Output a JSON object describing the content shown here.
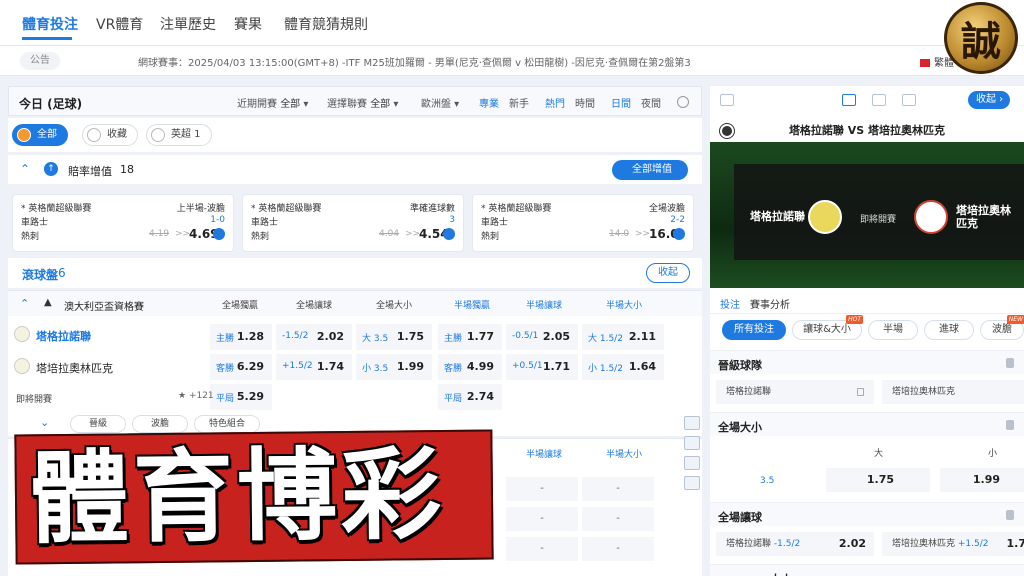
{
  "topnav": {
    "tabs": [
      "體育投注",
      "VR體育",
      "注單歷史",
      "賽果",
      "體育競猜規則"
    ],
    "logo_char": "誠"
  },
  "notice": {
    "label": "公告",
    "text": "網球賽事：2025/04/03 13:15:00(GMT+8) -ITF M25班加羅爾 - 男單(尼克·查佩爾 v 松田龍樹) -因尼克·查佩爾在第2盤第3",
    "lang": "繁體"
  },
  "main": {
    "title": "今日 (足球)",
    "filters": [
      {
        "label": "近期開賽",
        "value": "全部"
      },
      {
        "label": "選擇聯賽",
        "value": "全部"
      },
      {
        "label": "歐洲盤",
        "value": ""
      }
    ],
    "toggles": [
      "專業",
      "新手",
      "熱門",
      "時間",
      "日間",
      "夜間"
    ],
    "chips": [
      "全部",
      "收藏",
      "英超 1"
    ],
    "boost": {
      "title": "賠率增值",
      "count": "18",
      "all_label": "全部增值"
    },
    "boost_cards": [
      {
        "league": "* 英格蘭超級聯賽",
        "market": "上半場-波膽",
        "team1": "車路士",
        "hc": "1-0",
        "team2": "熱刺",
        "old": "4.19",
        "arrow": ">>",
        "new": "4.69"
      },
      {
        "league": "* 英格蘭超級聯賽",
        "market": "準確進球數",
        "team1": "車路士",
        "hc": "3",
        "team2": "熱刺",
        "old": "4.04",
        "arrow": ">>",
        "new": "4.54"
      },
      {
        "league": "* 英格蘭超級聯賽",
        "market": "全場波膽",
        "team1": "車路士",
        "hc": "2-2",
        "team2": "熱刺",
        "old": "14.0",
        "arrow": ">>",
        "new": "16.0"
      }
    ],
    "live": {
      "title": "滾球盤",
      "count": "6",
      "collapse": "收起"
    },
    "league": {
      "name": "澳大利亞盃資格賽",
      "cols": [
        "全場獨贏",
        "全場讓球",
        "全場大小",
        "半場獨贏",
        "半場讓球",
        "半場大小"
      ]
    },
    "match": {
      "home": "塔格拉諾聯",
      "away": "塔培拉奧林匹克",
      "status": "即將開賽",
      "more": "+121",
      "home_odds": [
        [
          "主勝",
          "1.28"
        ],
        [
          "-1.5/2",
          "2.02"
        ],
        [
          "大 3.5",
          "1.75"
        ],
        [
          "主勝",
          "1.77"
        ],
        [
          "-0.5/1",
          "2.05"
        ],
        [
          "大 1.5/2",
          "2.11"
        ]
      ],
      "away_odds": [
        [
          "客勝",
          "6.29"
        ],
        [
          "+1.5/2",
          "1.74"
        ],
        [
          "小 3.5",
          "1.99"
        ],
        [
          "客勝",
          "4.99"
        ],
        [
          "+0.5/1",
          "1.71"
        ],
        [
          "小 1.5/2",
          "1.64"
        ]
      ],
      "draw_odds": [
        [
          "平局",
          "5.29"
        ],
        [
          "平局",
          "2.74"
        ]
      ]
    },
    "subtabs": [
      "晉級",
      "波膽",
      "特色組合"
    ],
    "lower_cols": [
      "半場讓球",
      "半場大小"
    ],
    "dash": "-"
  },
  "right": {
    "collapse": "收起",
    "vs_title": "塔格拉諾聯  VS  塔培拉奧林匹克",
    "home": "塔格拉諾聯",
    "away": "塔培拉奧林匹克",
    "soon": "即將開賽",
    "tabs": [
      "投注",
      "賽事分析"
    ],
    "filters": [
      "所有投注",
      "讓球&大小",
      "半場",
      "進球",
      "波膽"
    ],
    "hot": "HOT",
    "new_tag": "NEW",
    "sections": {
      "advance": "晉級球隊",
      "ou": "全場大小",
      "hcp": "全場讓球",
      "ou_half": "大小"
    },
    "advance_home": "塔格拉諾聯",
    "advance_away": "塔培拉奧林匹克",
    "ou_over": "大",
    "ou_under": "小",
    "ou_line": "3.5",
    "ou_over_odds": "1.75",
    "ou_under_odds": "1.99",
    "hcp_home": "塔格拉諾聯",
    "hcp_home_line": "-1.5/2",
    "hcp_home_odds": "2.02",
    "hcp_away": "塔培拉奧林匹克",
    "hcp_away_line": "+1.5/2",
    "hcp_away_odds": "1.74",
    "hcp_away_odds_partial": "1.7"
  },
  "banner": {
    "text": "體育博彩"
  }
}
